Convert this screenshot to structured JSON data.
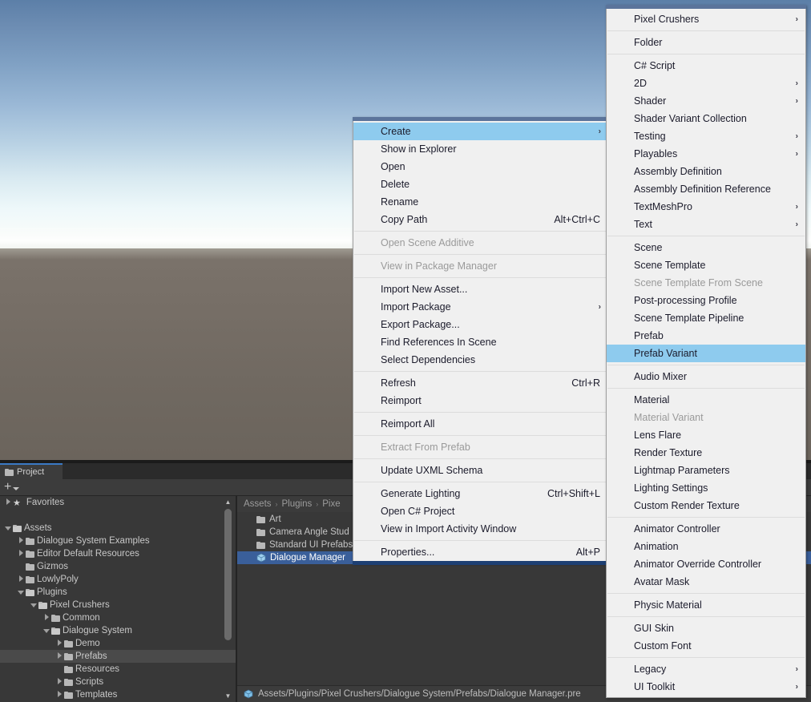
{
  "window": {
    "scene_view": {
      "name": "scene-view"
    }
  },
  "project_panel": {
    "tab_label": "Project",
    "tab_icon": "folder-icon",
    "toolbar": {
      "add_label": "+",
      "caret_icon": "chevron-down-icon"
    },
    "tree": [
      {
        "label": "Favorites",
        "depth": 0,
        "twisty": "right",
        "icon": "star-icon",
        "selected": false
      },
      {
        "label": "",
        "depth": 0,
        "twisty": "none",
        "icon": "none",
        "spacer": true,
        "selected": false
      },
      {
        "label": "Assets",
        "depth": 0,
        "twisty": "down",
        "icon": "folder-open-icon",
        "selected": false
      },
      {
        "label": "Dialogue System Examples",
        "depth": 1,
        "twisty": "right",
        "icon": "folder-icon",
        "selected": false
      },
      {
        "label": "Editor Default Resources",
        "depth": 1,
        "twisty": "right",
        "icon": "folder-icon",
        "selected": false
      },
      {
        "label": "Gizmos",
        "depth": 1,
        "twisty": "none",
        "icon": "folder-icon",
        "selected": false
      },
      {
        "label": "LowlyPoly",
        "depth": 1,
        "twisty": "right",
        "icon": "folder-icon",
        "selected": false
      },
      {
        "label": "Plugins",
        "depth": 1,
        "twisty": "down",
        "icon": "folder-open-icon",
        "selected": false
      },
      {
        "label": "Pixel Crushers",
        "depth": 2,
        "twisty": "down",
        "icon": "folder-open-icon",
        "selected": false
      },
      {
        "label": "Common",
        "depth": 3,
        "twisty": "right",
        "icon": "folder-icon",
        "selected": false
      },
      {
        "label": "Dialogue System",
        "depth": 3,
        "twisty": "down",
        "icon": "folder-open-icon",
        "selected": false
      },
      {
        "label": "Demo",
        "depth": 4,
        "twisty": "right",
        "icon": "folder-icon",
        "selected": false
      },
      {
        "label": "Prefabs",
        "depth": 4,
        "twisty": "right",
        "icon": "folder-icon",
        "selected": true
      },
      {
        "label": "Resources",
        "depth": 4,
        "twisty": "none",
        "icon": "folder-icon",
        "selected": false
      },
      {
        "label": "Scripts",
        "depth": 4,
        "twisty": "right",
        "icon": "folder-icon",
        "selected": false
      },
      {
        "label": "Templates",
        "depth": 4,
        "twisty": "right",
        "icon": "folder-icon",
        "selected": false
      }
    ],
    "breadcrumb": [
      "Assets",
      "Plugins",
      "Pixe"
    ],
    "breadcrumb_separator": "›",
    "assets": [
      {
        "label": "Art",
        "icon": "folder-icon",
        "selected": false
      },
      {
        "label": "Camera Angle Stud",
        "icon": "folder-icon",
        "selected": false
      },
      {
        "label": "Standard UI Prefabs",
        "icon": "folder-icon",
        "selected": false
      },
      {
        "label": "Dialogue Manager",
        "icon": "prefab-cube-icon",
        "selected": true
      }
    ],
    "status_bar": {
      "icon": "prefab-cube-icon",
      "path": "Assets/Plugins/Pixel Crushers/Dialogue System/Prefabs/Dialogue Manager.pre"
    }
  },
  "context_menu_main": {
    "name": "asset-context-menu",
    "items": [
      {
        "label": "Create",
        "shortcut": "",
        "submenu": true,
        "disabled": false,
        "selected": true
      },
      {
        "label": "Show in Explorer",
        "shortcut": "",
        "submenu": false,
        "disabled": false,
        "selected": false
      },
      {
        "label": "Open",
        "shortcut": "",
        "submenu": false,
        "disabled": false,
        "selected": false
      },
      {
        "label": "Delete",
        "shortcut": "",
        "submenu": false,
        "disabled": false,
        "selected": false
      },
      {
        "label": "Rename",
        "shortcut": "",
        "submenu": false,
        "disabled": false,
        "selected": false
      },
      {
        "label": "Copy Path",
        "shortcut": "Alt+Ctrl+C",
        "submenu": false,
        "disabled": false,
        "selected": false
      },
      {
        "separator": true
      },
      {
        "label": "Open Scene Additive",
        "shortcut": "",
        "submenu": false,
        "disabled": true,
        "selected": false
      },
      {
        "separator": true
      },
      {
        "label": "View in Package Manager",
        "shortcut": "",
        "submenu": false,
        "disabled": true,
        "selected": false
      },
      {
        "separator": true
      },
      {
        "label": "Import New Asset...",
        "shortcut": "",
        "submenu": false,
        "disabled": false,
        "selected": false
      },
      {
        "label": "Import Package",
        "shortcut": "",
        "submenu": true,
        "disabled": false,
        "selected": false
      },
      {
        "label": "Export Package...",
        "shortcut": "",
        "submenu": false,
        "disabled": false,
        "selected": false
      },
      {
        "label": "Find References In Scene",
        "shortcut": "",
        "submenu": false,
        "disabled": false,
        "selected": false
      },
      {
        "label": "Select Dependencies",
        "shortcut": "",
        "submenu": false,
        "disabled": false,
        "selected": false
      },
      {
        "separator": true
      },
      {
        "label": "Refresh",
        "shortcut": "Ctrl+R",
        "submenu": false,
        "disabled": false,
        "selected": false
      },
      {
        "label": "Reimport",
        "shortcut": "",
        "submenu": false,
        "disabled": false,
        "selected": false
      },
      {
        "separator": true
      },
      {
        "label": "Reimport All",
        "shortcut": "",
        "submenu": false,
        "disabled": false,
        "selected": false
      },
      {
        "separator": true
      },
      {
        "label": "Extract From Prefab",
        "shortcut": "",
        "submenu": false,
        "disabled": true,
        "selected": false
      },
      {
        "separator": true
      },
      {
        "label": "Update UXML Schema",
        "shortcut": "",
        "submenu": false,
        "disabled": false,
        "selected": false
      },
      {
        "separator": true
      },
      {
        "label": "Generate Lighting",
        "shortcut": "Ctrl+Shift+L",
        "submenu": false,
        "disabled": false,
        "selected": false
      },
      {
        "label": "Open C# Project",
        "shortcut": "",
        "submenu": false,
        "disabled": false,
        "selected": false
      },
      {
        "label": "View in Import Activity Window",
        "shortcut": "",
        "submenu": false,
        "disabled": false,
        "selected": false
      },
      {
        "separator": true
      },
      {
        "label": "Properties...",
        "shortcut": "Alt+P",
        "submenu": false,
        "disabled": false,
        "selected": false
      }
    ]
  },
  "context_menu_create": {
    "name": "create-submenu",
    "items": [
      {
        "label": "Pixel Crushers",
        "submenu": true,
        "disabled": false,
        "selected": false
      },
      {
        "separator": true
      },
      {
        "label": "Folder",
        "submenu": false,
        "disabled": false,
        "selected": false
      },
      {
        "separator": true
      },
      {
        "label": "C# Script",
        "submenu": false,
        "disabled": false,
        "selected": false
      },
      {
        "label": "2D",
        "submenu": true,
        "disabled": false,
        "selected": false
      },
      {
        "label": "Shader",
        "submenu": true,
        "disabled": false,
        "selected": false
      },
      {
        "label": "Shader Variant Collection",
        "submenu": false,
        "disabled": false,
        "selected": false
      },
      {
        "label": "Testing",
        "submenu": true,
        "disabled": false,
        "selected": false
      },
      {
        "label": "Playables",
        "submenu": true,
        "disabled": false,
        "selected": false
      },
      {
        "label": "Assembly Definition",
        "submenu": false,
        "disabled": false,
        "selected": false
      },
      {
        "label": "Assembly Definition Reference",
        "submenu": false,
        "disabled": false,
        "selected": false
      },
      {
        "label": "TextMeshPro",
        "submenu": true,
        "disabled": false,
        "selected": false
      },
      {
        "label": "Text",
        "submenu": true,
        "disabled": false,
        "selected": false
      },
      {
        "separator": true
      },
      {
        "label": "Scene",
        "submenu": false,
        "disabled": false,
        "selected": false
      },
      {
        "label": "Scene Template",
        "submenu": false,
        "disabled": false,
        "selected": false
      },
      {
        "label": "Scene Template From Scene",
        "submenu": false,
        "disabled": true,
        "selected": false
      },
      {
        "label": "Post-processing Profile",
        "submenu": false,
        "disabled": false,
        "selected": false
      },
      {
        "label": "Scene Template Pipeline",
        "submenu": false,
        "disabled": false,
        "selected": false
      },
      {
        "label": "Prefab",
        "submenu": false,
        "disabled": false,
        "selected": false
      },
      {
        "label": "Prefab Variant",
        "submenu": false,
        "disabled": false,
        "selected": true
      },
      {
        "separator": true
      },
      {
        "label": "Audio Mixer",
        "submenu": false,
        "disabled": false,
        "selected": false
      },
      {
        "separator": true
      },
      {
        "label": "Material",
        "submenu": false,
        "disabled": false,
        "selected": false
      },
      {
        "label": "Material Variant",
        "submenu": false,
        "disabled": true,
        "selected": false
      },
      {
        "label": "Lens Flare",
        "submenu": false,
        "disabled": false,
        "selected": false
      },
      {
        "label": "Render Texture",
        "submenu": false,
        "disabled": false,
        "selected": false
      },
      {
        "label": "Lightmap Parameters",
        "submenu": false,
        "disabled": false,
        "selected": false
      },
      {
        "label": "Lighting Settings",
        "submenu": false,
        "disabled": false,
        "selected": false
      },
      {
        "label": "Custom Render Texture",
        "submenu": false,
        "disabled": false,
        "selected": false
      },
      {
        "separator": true
      },
      {
        "label": "Animator Controller",
        "submenu": false,
        "disabled": false,
        "selected": false
      },
      {
        "label": "Animation",
        "submenu": false,
        "disabled": false,
        "selected": false
      },
      {
        "label": "Animator Override Controller",
        "submenu": false,
        "disabled": false,
        "selected": false
      },
      {
        "label": "Avatar Mask",
        "submenu": false,
        "disabled": false,
        "selected": false
      },
      {
        "separator": true
      },
      {
        "label": "Physic Material",
        "submenu": false,
        "disabled": false,
        "selected": false
      },
      {
        "separator": true
      },
      {
        "label": "GUI Skin",
        "submenu": false,
        "disabled": false,
        "selected": false
      },
      {
        "label": "Custom Font",
        "submenu": false,
        "disabled": false,
        "selected": false
      },
      {
        "separator": true
      },
      {
        "label": "Legacy",
        "submenu": true,
        "disabled": false,
        "selected": false
      },
      {
        "label": "UI Toolkit",
        "submenu": true,
        "disabled": false,
        "selected": false
      }
    ]
  },
  "colors": {
    "menu_bg": "#f0f0f0",
    "menu_highlight": "#8ecbee",
    "menu_text": "#1b1b2b",
    "menu_text_disabled": "#9a9a9a",
    "panel_bg": "#383838",
    "selection_blue": "#3a5f9a",
    "tab_accent": "#3a79c4"
  },
  "icons": {
    "submenu_arrow": "›",
    "twisty_right": "chevron-right-icon",
    "twisty_down": "chevron-down-icon",
    "star": "★",
    "scroll_up": "▲",
    "scroll_down": "▼"
  }
}
